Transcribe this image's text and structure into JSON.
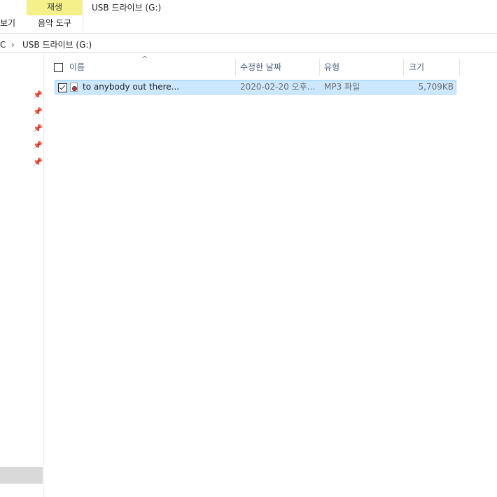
{
  "ribbon": {
    "context_tab_label": "재생",
    "context_tools_label": "음악 도구",
    "view_tab_label": "보기",
    "window_title": "USB 드라이브 (G:)"
  },
  "address": {
    "prefix": "C",
    "separator": "›",
    "location": "USB 드라이브 (G:)"
  },
  "columns": {
    "name": "이름",
    "modified": "수정한 날짜",
    "type": "유형",
    "size": "크기"
  },
  "files": [
    {
      "name": "to anybody out there...",
      "modified": "2020-02-20 오후...",
      "type": "MP3 파일",
      "size": "5,709KB",
      "selected": true,
      "icon": "mp3-file-icon"
    }
  ],
  "nav": {
    "pin_icon": "pin-icon",
    "pins": 5
  },
  "colors": {
    "context_tab": "#f6f08a",
    "selection_bg": "#cce8ff",
    "selection_border": "#99d1ff",
    "header_text": "#4c607a"
  }
}
